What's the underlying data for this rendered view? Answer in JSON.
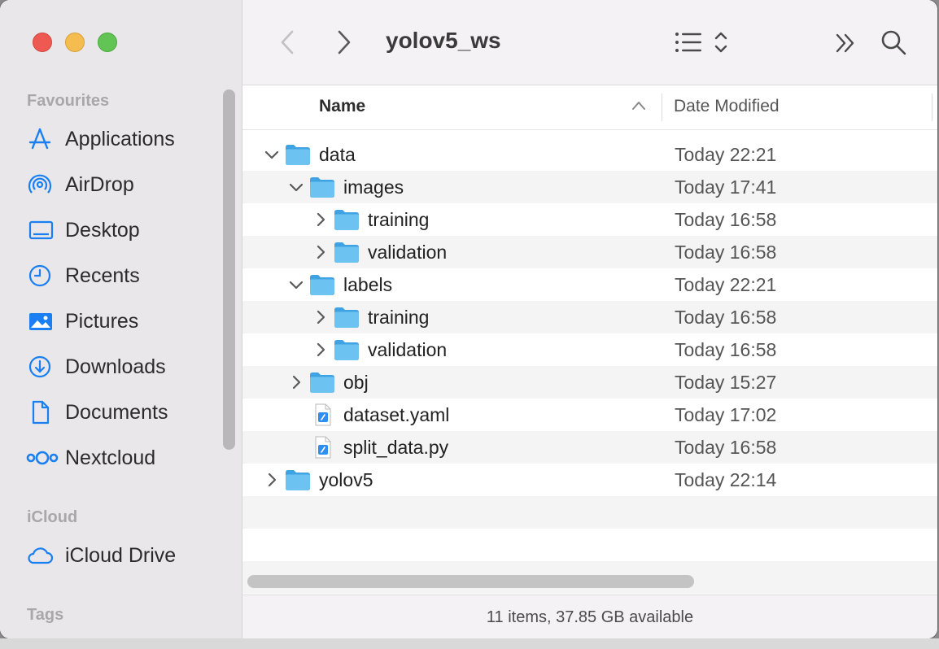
{
  "window": {
    "title": "yolov5_ws"
  },
  "sidebar": {
    "favourites_title": "Favourites",
    "items": [
      {
        "label": "Applications",
        "icon": "applications-icon"
      },
      {
        "label": "AirDrop",
        "icon": "airdrop-icon"
      },
      {
        "label": "Desktop",
        "icon": "desktop-icon"
      },
      {
        "label": "Recents",
        "icon": "clock-icon"
      },
      {
        "label": "Pictures",
        "icon": "pictures-icon"
      },
      {
        "label": "Downloads",
        "icon": "download-icon"
      },
      {
        "label": "Documents",
        "icon": "document-icon"
      },
      {
        "label": "Nextcloud",
        "icon": "nextcloud-icon"
      }
    ],
    "icloud_title": "iCloud",
    "icloud_items": [
      {
        "label": "iCloud Drive",
        "icon": "cloud-icon"
      }
    ],
    "tags_title": "Tags"
  },
  "columns": {
    "name": "Name",
    "date": "Date Modified"
  },
  "files": [
    {
      "name": "data",
      "date": "Today 22:21",
      "type": "folder",
      "level": 0,
      "expanded": true,
      "has_children": true
    },
    {
      "name": "images",
      "date": "Today 17:41",
      "type": "folder",
      "level": 1,
      "expanded": true,
      "has_children": true
    },
    {
      "name": "training",
      "date": "Today 16:58",
      "type": "folder",
      "level": 2,
      "expanded": false,
      "has_children": true
    },
    {
      "name": "validation",
      "date": "Today 16:58",
      "type": "folder",
      "level": 2,
      "expanded": false,
      "has_children": true
    },
    {
      "name": "labels",
      "date": "Today 22:21",
      "type": "folder",
      "level": 1,
      "expanded": true,
      "has_children": true
    },
    {
      "name": "training",
      "date": "Today 16:58",
      "type": "folder",
      "level": 2,
      "expanded": false,
      "has_children": true
    },
    {
      "name": "validation",
      "date": "Today 16:58",
      "type": "folder",
      "level": 2,
      "expanded": false,
      "has_children": true
    },
    {
      "name": "obj",
      "date": "Today 15:27",
      "type": "folder",
      "level": 1,
      "expanded": false,
      "has_children": true
    },
    {
      "name": "dataset.yaml",
      "date": "Today 17:02",
      "type": "file",
      "level": 1,
      "expanded": false,
      "has_children": false
    },
    {
      "name": "split_data.py",
      "date": "Today 16:58",
      "type": "file",
      "level": 1,
      "expanded": false,
      "has_children": false
    },
    {
      "name": "yolov5",
      "date": "Today 22:14",
      "type": "folder",
      "level": 0,
      "expanded": false,
      "has_children": true
    }
  ],
  "status": {
    "text": "11 items, 37.85 GB available"
  },
  "colors": {
    "accent": "#1a7ff2",
    "folder": "#5ab7ec",
    "sidebar_bg": "#e9e7e9"
  }
}
